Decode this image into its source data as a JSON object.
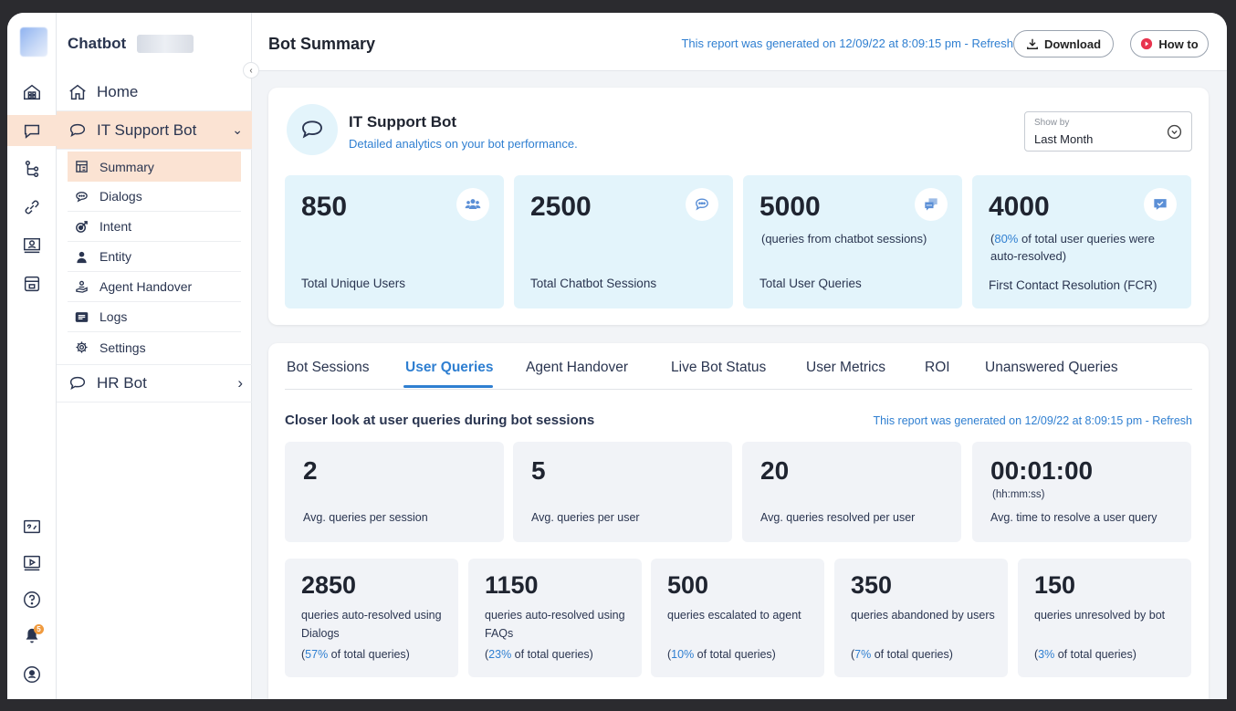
{
  "app": {
    "brand": "Chatbot",
    "page_title": "Bot Summary",
    "report_prefix": "This report was generated on 12/09/22 at 8:09:15 pm - ",
    "refresh_label": "Refresh",
    "download_label": "Download",
    "howto_label": "How to"
  },
  "sidebar": {
    "home": "Home",
    "bot": "IT Support Bot",
    "items": [
      "Summary",
      "Dialogs",
      "Intent",
      "Entity",
      "Agent Handover",
      "Logs",
      "Settings"
    ],
    "hr_bot": "HR Bot",
    "bell_count": "5"
  },
  "overview": {
    "bot_name": "IT Support Bot",
    "bot_desc": "Detailed analytics on your bot performance.",
    "showby_label": "Show by",
    "showby_value": "Last Month",
    "stats": [
      {
        "value": "850",
        "sub": "",
        "label": "Total Unique Users",
        "icon": "users-icon"
      },
      {
        "value": "2500",
        "sub": "",
        "label": "Total Chatbot Sessions",
        "icon": "chat-bubble-icon"
      },
      {
        "value": "5000",
        "sub": "(queries from chatbot sessions)",
        "label": "Total User Queries",
        "icon": "queries-icon"
      },
      {
        "value": "4000",
        "sub_pct": "80%",
        "sub": " of total user queries were auto-resolved)",
        "sub_open": "(",
        "label": "First Contact Resolution (FCR)",
        "icon": "resolved-icon"
      }
    ]
  },
  "tabs": [
    "Bot Sessions",
    "User Queries",
    "Agent Handover",
    "Live Bot Status",
    "User Metrics",
    "ROI",
    "Unanswered Queries"
  ],
  "queries": {
    "title": "Closer look at user queries during bot sessions",
    "metrics": [
      {
        "value": "2",
        "unit": "",
        "label": "Avg. queries per session"
      },
      {
        "value": "5",
        "unit": "",
        "label": "Avg. queries per user"
      },
      {
        "value": "20",
        "unit": "",
        "label": "Avg. queries resolved per user"
      },
      {
        "value": "00:01:00",
        "unit": "(hh:mm:ss)",
        "label": "Avg. time to resolve a user query"
      }
    ],
    "breakdown": [
      {
        "value": "2850",
        "desc": "queries auto-resolved using Dialogs",
        "pct": "57%",
        "pct_suffix": " of total queries)"
      },
      {
        "value": "1150",
        "desc": "queries auto-resolved using FAQs",
        "pct": "23%",
        "pct_suffix": " of total queries)"
      },
      {
        "value": "500",
        "desc": "queries escalated to agent",
        "pct": "10%",
        "pct_suffix": " of total queries)"
      },
      {
        "value": "350",
        "desc": "queries abandoned by users",
        "pct": "7%",
        "pct_suffix": " of total queries)"
      },
      {
        "value": "150",
        "desc": "queries unresolved by bot",
        "pct": "3%",
        "pct_suffix": " of total queries)"
      }
    ]
  },
  "colors": {
    "accent": "#2f7fd1",
    "active_bg": "#fbe3d3",
    "tile_blue": "#e3f4fb",
    "tile_grey": "#f1f3f7",
    "record": "#e8344e"
  }
}
